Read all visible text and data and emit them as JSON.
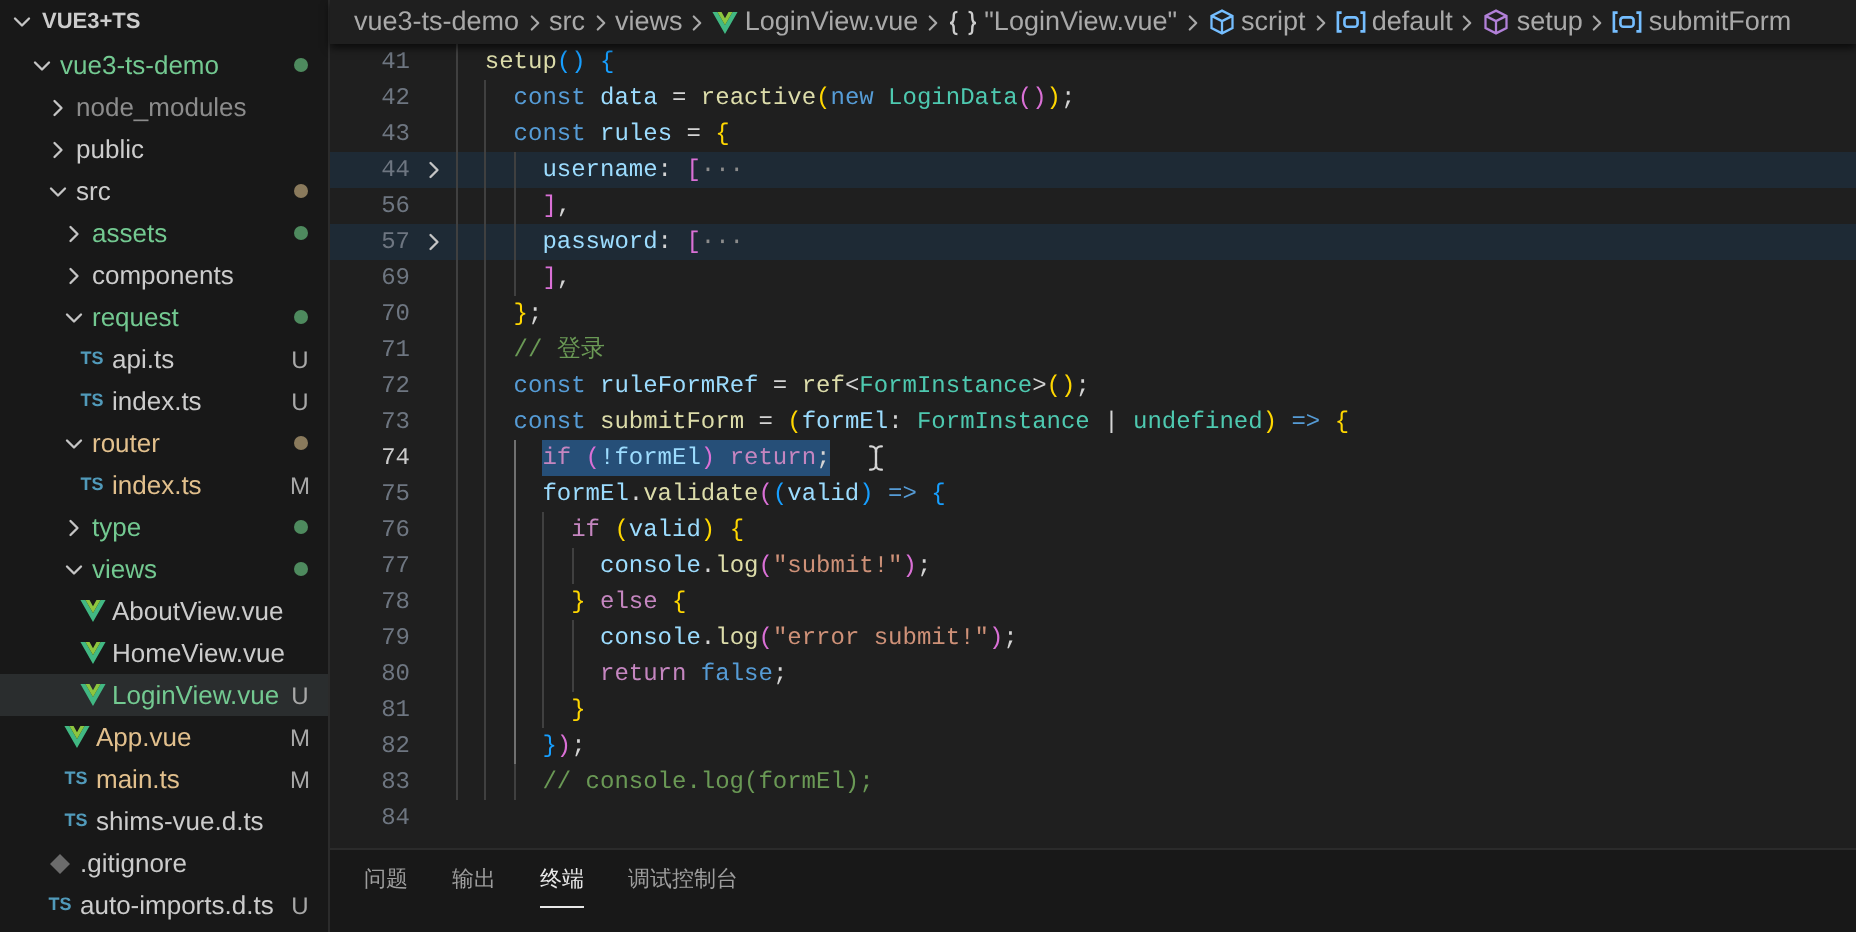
{
  "explorer": {
    "title": "VUE3+TS",
    "expanded": true,
    "items": [
      {
        "label": "vue3-ts-demo",
        "kind": "folder",
        "expanded": true,
        "selected": false,
        "color": "#73c991",
        "dot": {
          "color": "#4e8a5e"
        },
        "children": [
          {
            "label": "node_modules",
            "kind": "folder",
            "expanded": false,
            "selected": false,
            "color": "#8c8c8c"
          },
          {
            "label": "public",
            "kind": "folder",
            "expanded": false,
            "selected": false,
            "color": "#cccccc"
          },
          {
            "label": "src",
            "kind": "folder",
            "expanded": true,
            "selected": false,
            "color": "#cccccc",
            "dot": {
              "color": "#8a7a5c"
            },
            "children": [
              {
                "label": "assets",
                "kind": "folder",
                "expanded": false,
                "selected": false,
                "color": "#73c991",
                "dot": {
                  "color": "#4e8a5e"
                }
              },
              {
                "label": "components",
                "kind": "folder",
                "expanded": false,
                "selected": false,
                "color": "#cccccc"
              },
              {
                "label": "request",
                "kind": "folder",
                "expanded": true,
                "selected": false,
                "color": "#73c991",
                "dot": {
                  "color": "#4e8a5e"
                },
                "children": [
                  {
                    "label": "api.ts",
                    "kind": "ts",
                    "icon_label": "TS",
                    "selected": false,
                    "color": "#cccccc",
                    "badge": "U"
                  },
                  {
                    "label": "index.ts",
                    "kind": "ts",
                    "icon_label": "TS",
                    "selected": false,
                    "color": "#cccccc",
                    "badge": "U"
                  }
                ]
              },
              {
                "label": "router",
                "kind": "folder",
                "expanded": true,
                "selected": false,
                "color": "#e2c08d",
                "dot": {
                  "color": "#8a7a5c"
                },
                "children": [
                  {
                    "label": "index.ts",
                    "kind": "ts",
                    "icon_label": "TS",
                    "selected": false,
                    "color": "#e2c08d",
                    "badge": "M"
                  }
                ]
              },
              {
                "label": "type",
                "kind": "folder",
                "expanded": false,
                "selected": false,
                "color": "#73c991",
                "dot": {
                  "color": "#4e8a5e"
                }
              },
              {
                "label": "views",
                "kind": "folder",
                "expanded": true,
                "selected": false,
                "color": "#73c991",
                "dot": {
                  "color": "#4e8a5e"
                },
                "children": [
                  {
                    "label": "AboutView.vue",
                    "kind": "vue",
                    "selected": false,
                    "color": "#cccccc"
                  },
                  {
                    "label": "HomeView.vue",
                    "kind": "vue",
                    "selected": false,
                    "color": "#cccccc"
                  },
                  {
                    "label": "LoginView.vue",
                    "kind": "vue",
                    "selected": true,
                    "color": "#73c991",
                    "badge": "U"
                  }
                ]
              },
              {
                "label": "App.vue",
                "kind": "vue",
                "selected": false,
                "color": "#e2c08d",
                "badge": "M"
              },
              {
                "label": "main.ts",
                "kind": "ts",
                "icon_label": "TS",
                "selected": false,
                "color": "#e2c08d",
                "badge": "M"
              },
              {
                "label": "shims-vue.d.ts",
                "kind": "ts",
                "icon_label": "TS",
                "selected": false,
                "color": "#cccccc"
              }
            ]
          },
          {
            "label": ".gitignore",
            "kind": "git",
            "selected": false,
            "color": "#cccccc"
          },
          {
            "label": "auto-imports.d.ts",
            "kind": "ts",
            "icon_label": "TS",
            "selected": false,
            "color": "#cccccc",
            "badge": "U"
          }
        ]
      }
    ]
  },
  "breadcrumb": [
    {
      "label": "vue3-ts-demo",
      "kind": "folder"
    },
    {
      "label": "src",
      "kind": "folder"
    },
    {
      "label": "views",
      "kind": "folder"
    },
    {
      "label": "LoginView.vue",
      "kind": "file"
    },
    {
      "label": "\"LoginView.vue\"",
      "kind": "object"
    },
    {
      "label": "script",
      "kind": "module"
    },
    {
      "label": "default",
      "kind": "variable"
    },
    {
      "label": "setup",
      "kind": "method"
    },
    {
      "label": "submitForm",
      "kind": "variable"
    }
  ],
  "editor": {
    "lines": [
      {
        "n": "41",
        "folded": false,
        "current": false,
        "selected": false,
        "tokens": [
          {
            "text": "setup",
            "kind": "fn"
          },
          {
            "text": "()",
            "kind": "b3"
          },
          {
            "text": " {",
            "kind": "b3"
          }
        ]
      },
      {
        "n": "42",
        "folded": false,
        "current": false,
        "selected": false,
        "tokens": [
          {
            "text": "const",
            "kind": "kw"
          },
          {
            "text": " data",
            "kind": "var"
          },
          {
            "text": " =",
            "kind": "p"
          },
          {
            "text": " reactive",
            "kind": "fn"
          },
          {
            "text": "(",
            "kind": "b1"
          },
          {
            "text": "new",
            "kind": "kw"
          },
          {
            "text": " LoginData",
            "kind": "type"
          },
          {
            "text": "()",
            "kind": "b2"
          },
          {
            "text": ")",
            "kind": "b1"
          },
          {
            "text": ";",
            "kind": "p"
          }
        ]
      },
      {
        "n": "43",
        "folded": false,
        "current": false,
        "selected": false,
        "tokens": [
          {
            "text": "const",
            "kind": "kw"
          },
          {
            "text": " rules",
            "kind": "var"
          },
          {
            "text": " =",
            "kind": "p"
          },
          {
            "text": " {",
            "kind": "b1"
          }
        ]
      },
      {
        "n": "44",
        "folded": true,
        "current": false,
        "selected": false,
        "tokens": [
          {
            "text": "username",
            "kind": "var"
          },
          {
            "text": ":",
            "kind": "p"
          },
          {
            "text": " [",
            "kind": "b2"
          },
          {
            "text": "···",
            "kind": "fold"
          }
        ]
      },
      {
        "n": "56",
        "folded": false,
        "current": false,
        "selected": false,
        "tokens": [
          {
            "text": "]",
            "kind": "b2"
          },
          {
            "text": ",",
            "kind": "p"
          }
        ]
      },
      {
        "n": "57",
        "folded": true,
        "current": false,
        "selected": false,
        "tokens": [
          {
            "text": "password",
            "kind": "var"
          },
          {
            "text": ":",
            "kind": "p"
          },
          {
            "text": " [",
            "kind": "b2"
          },
          {
            "text": "···",
            "kind": "fold"
          }
        ]
      },
      {
        "n": "69",
        "folded": false,
        "current": false,
        "selected": false,
        "tokens": [
          {
            "text": "]",
            "kind": "b2"
          },
          {
            "text": ",",
            "kind": "p"
          }
        ]
      },
      {
        "n": "70",
        "folded": false,
        "current": false,
        "selected": false,
        "tokens": [
          {
            "text": "}",
            "kind": "b1"
          },
          {
            "text": ";",
            "kind": "p"
          }
        ]
      },
      {
        "n": "71",
        "folded": false,
        "current": false,
        "selected": false,
        "tokens": [
          {
            "text": "// 登录",
            "kind": "com"
          }
        ]
      },
      {
        "n": "72",
        "folded": false,
        "current": false,
        "selected": false,
        "tokens": [
          {
            "text": "const",
            "kind": "kw"
          },
          {
            "text": " ruleFormRef",
            "kind": "var"
          },
          {
            "text": " =",
            "kind": "p"
          },
          {
            "text": " ref",
            "kind": "fn"
          },
          {
            "text": "<",
            "kind": "p"
          },
          {
            "text": "FormInstance",
            "kind": "type"
          },
          {
            "text": ">",
            "kind": "p"
          },
          {
            "text": "()",
            "kind": "b1"
          },
          {
            "text": ";",
            "kind": "p"
          }
        ]
      },
      {
        "n": "73",
        "folded": false,
        "current": false,
        "selected": false,
        "tokens": [
          {
            "text": "const",
            "kind": "kw"
          },
          {
            "text": " submitForm",
            "kind": "fn"
          },
          {
            "text": " =",
            "kind": "p"
          },
          {
            "text": " (",
            "kind": "b1"
          },
          {
            "text": "formEl",
            "kind": "var"
          },
          {
            "text": ":",
            "kind": "p"
          },
          {
            "text": " FormInstance",
            "kind": "type"
          },
          {
            "text": " |",
            "kind": "p"
          },
          {
            "text": " undefined",
            "kind": "type"
          },
          {
            "text": ")",
            "kind": "b1"
          },
          {
            "text": " =>",
            "kind": "kw"
          },
          {
            "text": " {",
            "kind": "b1"
          }
        ]
      },
      {
        "n": "74",
        "folded": false,
        "current": true,
        "selected": true,
        "tokens": [
          {
            "text": "if",
            "kind": "ctl"
          },
          {
            "text": " (",
            "kind": "b2"
          },
          {
            "text": "!formEl",
            "kind": "var"
          },
          {
            "text": ")",
            "kind": "b2"
          },
          {
            "text": " return",
            "kind": "ctl"
          },
          {
            "text": ";",
            "kind": "p"
          }
        ]
      },
      {
        "n": "75",
        "folded": false,
        "current": false,
        "selected": false,
        "tokens": [
          {
            "text": "formEl",
            "kind": "var"
          },
          {
            "text": ".",
            "kind": "p"
          },
          {
            "text": "validate",
            "kind": "fn"
          },
          {
            "text": "(",
            "kind": "b2"
          },
          {
            "text": "(",
            "kind": "b3"
          },
          {
            "text": "valid",
            "kind": "var"
          },
          {
            "text": ")",
            "kind": "b3"
          },
          {
            "text": " =>",
            "kind": "kw"
          },
          {
            "text": " {",
            "kind": "b3"
          }
        ]
      },
      {
        "n": "76",
        "folded": false,
        "current": false,
        "selected": false,
        "tokens": [
          {
            "text": "if",
            "kind": "ctl"
          },
          {
            "text": " (",
            "kind": "b1"
          },
          {
            "text": "valid",
            "kind": "var"
          },
          {
            "text": ")",
            "kind": "b1"
          },
          {
            "text": " {",
            "kind": "b1"
          }
        ]
      },
      {
        "n": "77",
        "folded": false,
        "current": false,
        "selected": false,
        "tokens": [
          {
            "text": "console",
            "kind": "var"
          },
          {
            "text": ".",
            "kind": "p"
          },
          {
            "text": "log",
            "kind": "fn"
          },
          {
            "text": "(",
            "kind": "b2"
          },
          {
            "text": "\"submit!\"",
            "kind": "str"
          },
          {
            "text": ")",
            "kind": "b2"
          },
          {
            "text": ";",
            "kind": "p"
          }
        ]
      },
      {
        "n": "78",
        "folded": false,
        "current": false,
        "selected": false,
        "tokens": [
          {
            "text": "}",
            "kind": "b1"
          },
          {
            "text": " else",
            "kind": "ctl"
          },
          {
            "text": " {",
            "kind": "b1"
          }
        ]
      },
      {
        "n": "79",
        "folded": false,
        "current": false,
        "selected": false,
        "tokens": [
          {
            "text": "console",
            "kind": "var"
          },
          {
            "text": ".",
            "kind": "p"
          },
          {
            "text": "log",
            "kind": "fn"
          },
          {
            "text": "(",
            "kind": "b2"
          },
          {
            "text": "\"error submit!\"",
            "kind": "str"
          },
          {
            "text": ")",
            "kind": "b2"
          },
          {
            "text": ";",
            "kind": "p"
          }
        ]
      },
      {
        "n": "80",
        "folded": false,
        "current": false,
        "selected": false,
        "tokens": [
          {
            "text": "return",
            "kind": "ctl"
          },
          {
            "text": " false",
            "kind": "kw"
          },
          {
            "text": ";",
            "kind": "p"
          }
        ]
      },
      {
        "n": "81",
        "folded": false,
        "current": false,
        "selected": false,
        "tokens": [
          {
            "text": "}",
            "kind": "b1"
          }
        ]
      },
      {
        "n": "82",
        "folded": false,
        "current": false,
        "selected": false,
        "tokens": [
          {
            "text": "}",
            "kind": "b3"
          },
          {
            "text": ")",
            "kind": "b2"
          },
          {
            "text": ";",
            "kind": "p"
          }
        ]
      },
      {
        "n": "83",
        "folded": false,
        "current": false,
        "selected": false,
        "tokens": [
          {
            "text": "// console.log(formEl);",
            "kind": "com"
          }
        ]
      },
      {
        "n": "84",
        "folded": false,
        "current": false
      }
    ]
  },
  "panel": {
    "tabs": [
      {
        "label": "问题",
        "selected": false
      },
      {
        "label": "输出",
        "selected": false
      },
      {
        "label": "终端",
        "selected": true
      },
      {
        "label": "调试控制台",
        "selected": false
      }
    ]
  }
}
